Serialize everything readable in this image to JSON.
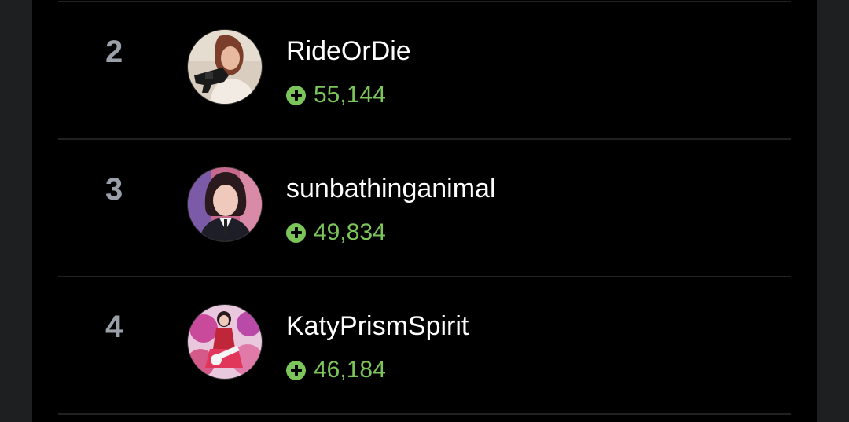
{
  "leaderboard": {
    "rows": [
      {
        "rank": "2",
        "username": "RideOrDie",
        "score": "55,144",
        "avatar_icon": "avatar-woman-with-camera"
      },
      {
        "rank": "3",
        "username": "sunbathinganimal",
        "score": "49,834",
        "avatar_icon": "avatar-woman-in-suit"
      },
      {
        "rank": "4",
        "username": "KatyPrismSpirit",
        "score": "46,184",
        "avatar_icon": "avatar-performer-with-guitar"
      }
    ]
  },
  "colors": {
    "background": "#000000",
    "rank": "#9aa0a8",
    "score_accent": "#7cc55a",
    "divider": "#1f2123"
  }
}
